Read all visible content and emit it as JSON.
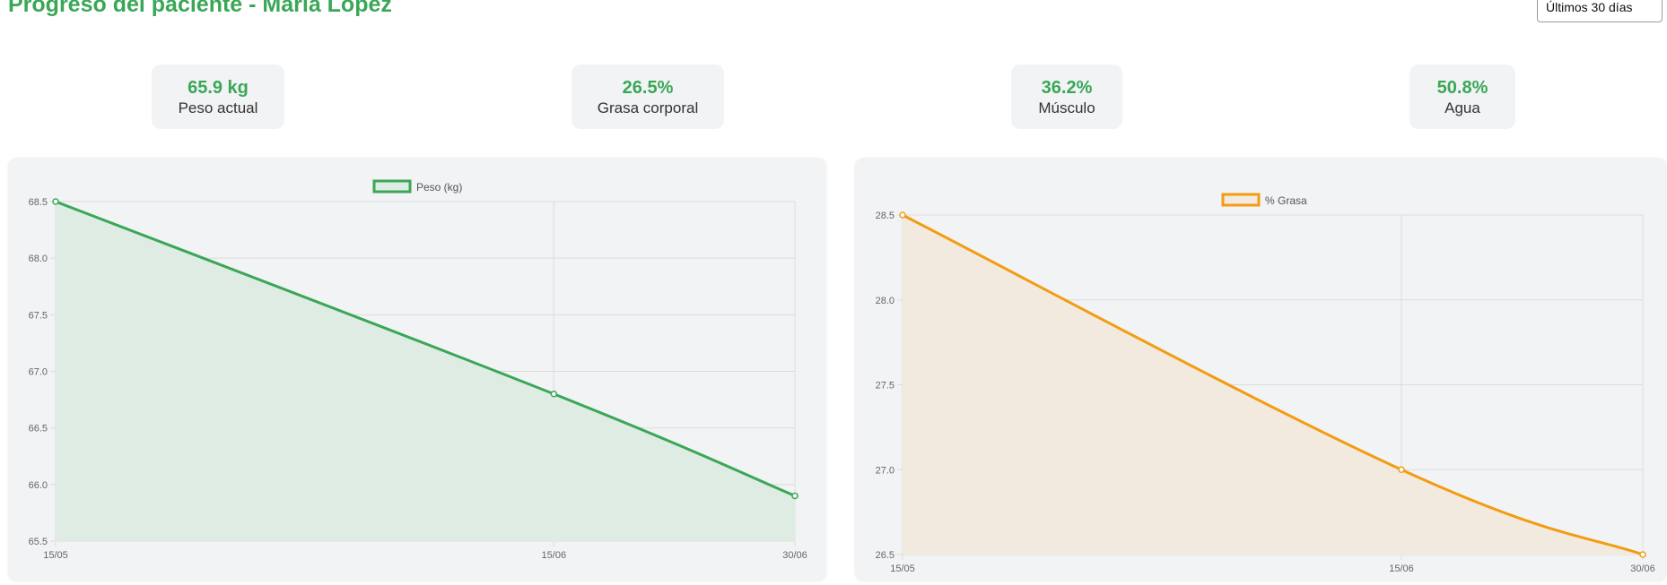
{
  "header": {
    "title": "Progreso del paciente - María López",
    "period_select": "Últimos 30 días"
  },
  "stats": [
    {
      "value": "65.9 kg",
      "label": "Peso actual"
    },
    {
      "value": "26.5%",
      "label": "Grasa corporal"
    },
    {
      "value": "36.2%",
      "label": "Músculo"
    },
    {
      "value": "50.8%",
      "label": "Agua"
    }
  ],
  "colors": {
    "accent": "#3aa757",
    "weight_line": "#3aa757",
    "fat_line": "#f39c12"
  },
  "chart_data": [
    {
      "type": "line",
      "categories": [
        "15/05",
        "15/06",
        "30/06"
      ],
      "series": [
        {
          "name": "Peso (kg)",
          "values": [
            68.5,
            66.8,
            65.9
          ],
          "color": "#3aa757",
          "fill": "#dfece4"
        }
      ],
      "yticks": [
        "68.5",
        "68.0",
        "67.5",
        "67.0",
        "66.5",
        "66.0",
        "65.5"
      ],
      "ylim": [
        65.5,
        68.5
      ],
      "legend": "top",
      "grid": true
    },
    {
      "type": "line",
      "categories": [
        "15/05",
        "15/06",
        "30/06"
      ],
      "series": [
        {
          "name": "% Grasa",
          "values": [
            28.5,
            27.0,
            26.5
          ],
          "color": "#f39c12",
          "fill": "#f3eadf"
        }
      ],
      "yticks": [
        "28.5",
        "28.0",
        "27.5",
        "27.0",
        "26.5"
      ],
      "ylim": [
        26.5,
        28.5
      ],
      "legend": "top",
      "grid": true
    }
  ]
}
